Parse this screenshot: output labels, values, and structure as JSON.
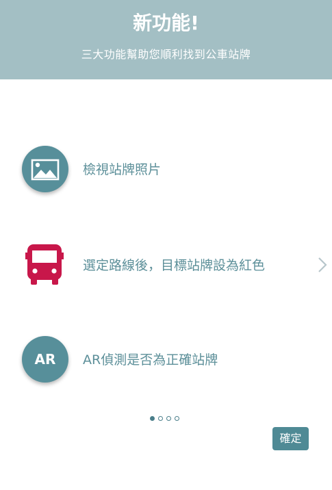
{
  "header": {
    "title": "新功能!",
    "subtitle": "三大功能幫助您順利找到公車站牌"
  },
  "features": [
    {
      "icon": "image-icon",
      "label": "檢視站牌照片"
    },
    {
      "icon": "bus-icon",
      "label": "選定路線後，目標站牌設為紅色"
    },
    {
      "icon": "ar-icon",
      "icon_text": "AR",
      "label": "AR偵測是否為正確站牌"
    }
  ],
  "pagination": {
    "total": 4,
    "current": 1
  },
  "confirm_label": "確定",
  "colors": {
    "header_bg": "#a3bfc4",
    "icon_circle": "#578f9a",
    "bus_red": "#c8174a",
    "text": "#5c8f99",
    "button_bg": "#4f8a95"
  }
}
